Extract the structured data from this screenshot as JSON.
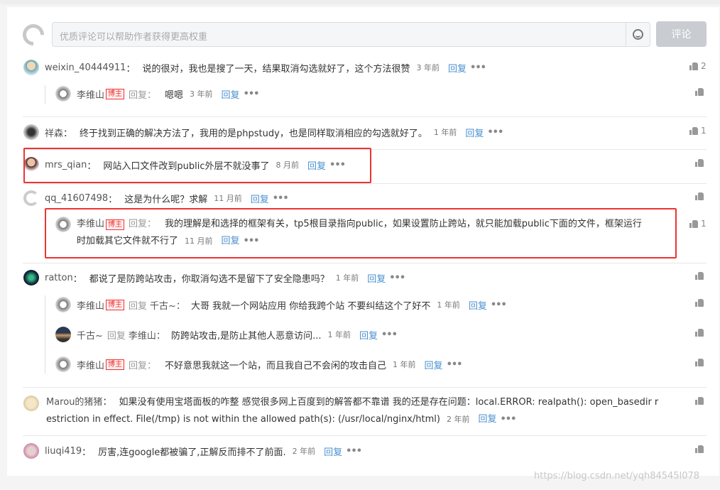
{
  "composer": {
    "placeholder": "优质评论可以帮助作者获得更高权重",
    "submit": "评论"
  },
  "c1": {
    "name": "weixin_40444911",
    "text": "说的很对，我也是搜了一天，结果取消勾选就好了，这个方法很赞",
    "time": "3 年前",
    "reply": "回复",
    "likes": "2"
  },
  "c1r": {
    "name": "李维山",
    "badge": "博主",
    "rep": "回复：",
    "text": "嗯嗯",
    "time": "3 年前",
    "reply": "回复"
  },
  "c2": {
    "name": "祥森",
    "text": "终于找到正确的解决方法了，我用的是phpstudy，也是同样取消相应的勾选就好了。",
    "time": "1 年前",
    "reply": "回复",
    "likes": "1"
  },
  "c3": {
    "name": "mrs_qian",
    "text": "网站入口文件改到public外层不就没事了",
    "time": "8 月前",
    "reply": "回复"
  },
  "c4": {
    "name": "qq_41607498",
    "text": "这是为什么呢？求解",
    "time": "11 月前",
    "reply": "回复"
  },
  "c4r": {
    "name": "李维山",
    "badge": "博主",
    "rep": "回复：",
    "text1": "我的理解是和选择的框架有关，tp5根目录指向public，如果设置防止跨站，就只能加载public下面的文件，框架运行",
    "text2": "时加载其它文件就不行了",
    "time": "11 月前",
    "reply": "回复",
    "likes": "1"
  },
  "c5": {
    "name": "ratton",
    "text": "都说了是防跨站攻击，你取消勾选不是留下了安全隐患吗？",
    "time": "1 年前",
    "reply": "回复"
  },
  "c5r1": {
    "name": "李维山",
    "badge": "博主",
    "rep": "回复",
    "target": "千古~：",
    "text": "大哥 我就一个网站应用 你给我跨个站 不要纠结这个了好不",
    "time": "1 年前",
    "reply": "回复"
  },
  "c5r2": {
    "name": "千古~",
    "rep": "回复",
    "target": "李维山：",
    "text": "防跨站攻击,是防止其他人恶意访问...",
    "time": "1 年前",
    "reply": "回复"
  },
  "c5r3": {
    "name": "李维山",
    "badge": "博主",
    "rep": "回复：",
    "text": "不好意思我就这一个站，而且我自己不会闲的攻击自己",
    "time": "1 年前",
    "reply": "回复"
  },
  "c6": {
    "name": "Marou的猪猪",
    "text1": "如果没有使用宝塔面板的咋整 感觉很多网上百度到的解答都不靠谱 我的还是存在问题：local.ERROR: realpath(): open_basedir r",
    "text2": "estriction in effect. File(/tmp) is not within the allowed path(s): (/usr/local/nginx/html)",
    "time": "2 年前",
    "reply": "回复"
  },
  "c7": {
    "name": "liuqi419",
    "text": "厉害,连google都被骗了,正解反而排不了前面.",
    "time": "2 年前",
    "reply": "回复"
  },
  "watermark": "https://blog.csdn.net/yqh84545l078"
}
